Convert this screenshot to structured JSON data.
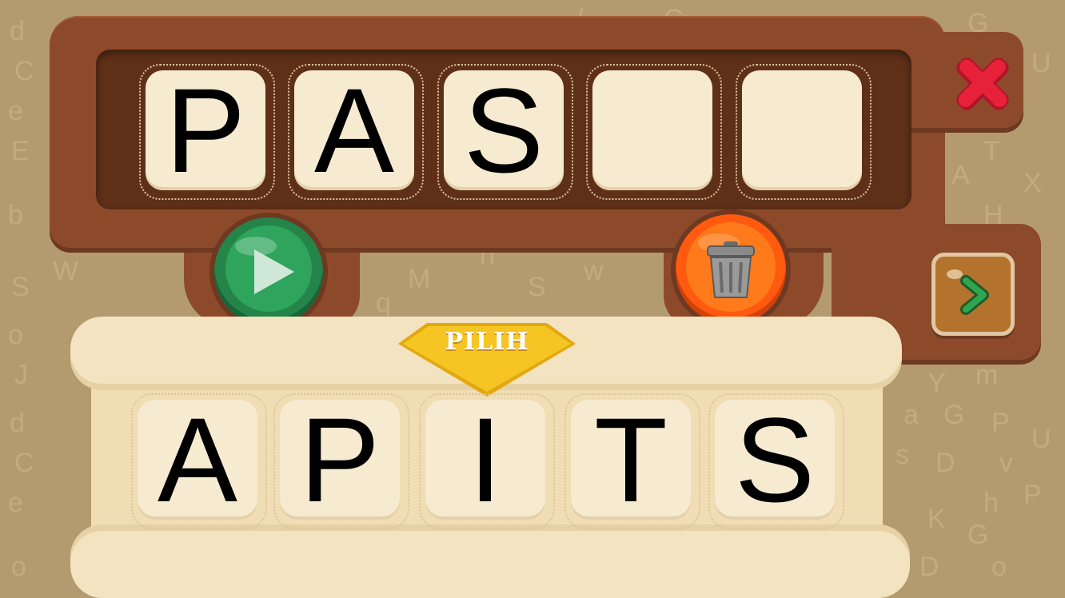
{
  "game": {
    "answer_slots": [
      "P",
      "A",
      "S",
      "",
      ""
    ],
    "choice_tiles": [
      "A",
      "P",
      "I",
      "T",
      "S"
    ],
    "choose_label": "PILIH"
  },
  "icons": {
    "close": "close-icon",
    "next": "chevron-right-icon",
    "play": "play-icon",
    "delete": "trash-icon"
  },
  "colors": {
    "wood": "#8d4a2b",
    "tray": "#5f3018",
    "tile": "#f6ead0",
    "parchment": "#f0ddb4",
    "play_button": "#24844a",
    "delete_button": "#ff5a10",
    "close_button": "#e8213b",
    "badge": "#f5c623"
  }
}
